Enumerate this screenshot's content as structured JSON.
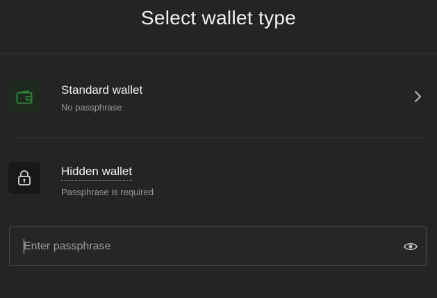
{
  "header": {
    "title": "Select wallet type"
  },
  "options": [
    {
      "title": "Standard wallet",
      "subtitle": "No passphrase",
      "icon": "wallet-icon",
      "accent": "#2f8a3d"
    },
    {
      "title": "Hidden wallet",
      "subtitle": "Passphrase is required",
      "icon": "lock-icon"
    }
  ],
  "passphrase": {
    "value": "",
    "placeholder": "Enter passphrase",
    "toggle_icon": "eye-icon"
  },
  "colors": {
    "background": "#242424",
    "divider": "#3a3a3a",
    "text_primary": "#f0f0f0",
    "text_secondary": "#9a9a9a"
  }
}
